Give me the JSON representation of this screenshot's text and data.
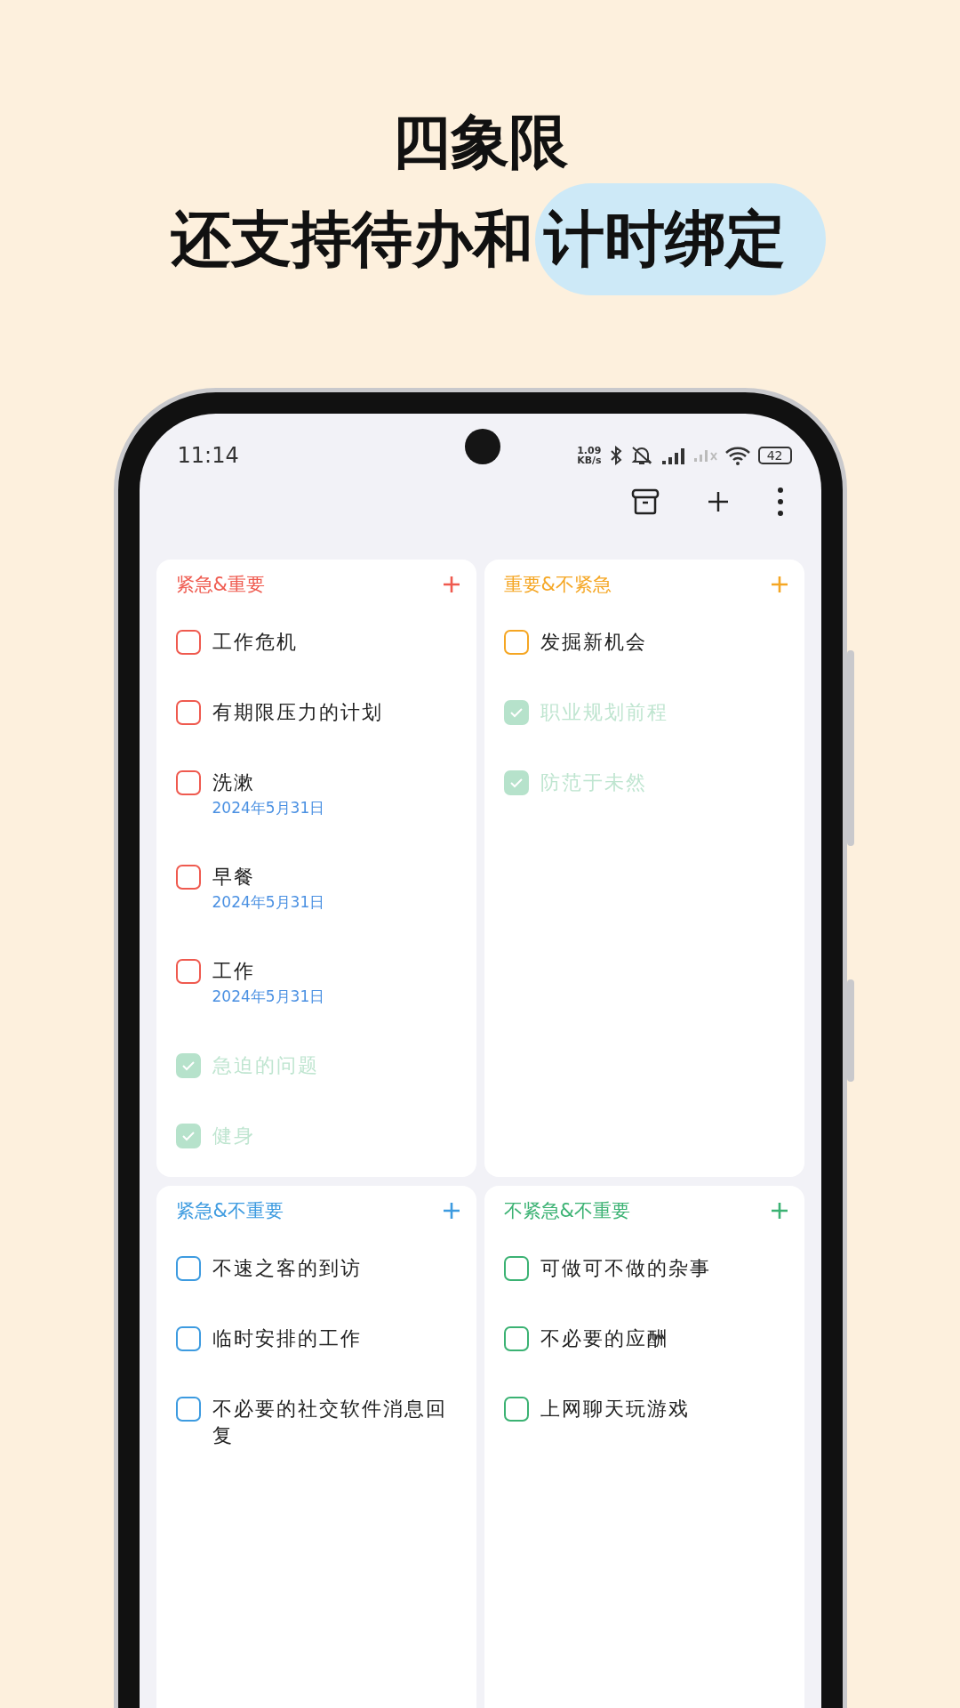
{
  "headline": {
    "line_1": "四象限",
    "line_2": "还支持待办和",
    "line_2_highlighted": "计时绑定"
  },
  "status_bar": {
    "time": "11:14",
    "net_speed": [
      "1.09",
      "KB/s"
    ],
    "battery": "42"
  },
  "quadrants": [
    {
      "title": "紧急&重要",
      "color": "#ef5a4f",
      "items": [
        {
          "text": "工作危机",
          "checked": false
        },
        {
          "text": "有期限压力的计划",
          "checked": false
        },
        {
          "text": "洗漱",
          "date": "2024年5月31日",
          "checked": false
        },
        {
          "text": "早餐",
          "date": "2024年5月31日",
          "checked": false
        },
        {
          "text": "工作",
          "date": "2024年5月31日",
          "checked": false
        },
        {
          "text": "急迫的问题",
          "checked": true
        },
        {
          "text": "健身",
          "checked": true
        }
      ]
    },
    {
      "title": "重要&不紧急",
      "color": "#f5a623",
      "items": [
        {
          "text": "发掘新机会",
          "checked": false
        },
        {
          "text": "职业规划前程",
          "checked": true
        },
        {
          "text": "防范于未然",
          "checked": true
        }
      ]
    },
    {
      "title": "紧急&不重要",
      "color": "#3d9be0",
      "items": [
        {
          "text": "不速之客的到访",
          "checked": false
        },
        {
          "text": "临时安排的工作",
          "checked": false
        },
        {
          "text": "不必要的社交软件消息回复",
          "checked": false
        }
      ]
    },
    {
      "title": "不紧急&不重要",
      "color": "#3bb273",
      "items": [
        {
          "text": "可做可不做的杂事",
          "checked": false
        },
        {
          "text": "不必要的应酬",
          "checked": false
        },
        {
          "text": "上网聊天玩游戏",
          "checked": false
        }
      ]
    }
  ]
}
